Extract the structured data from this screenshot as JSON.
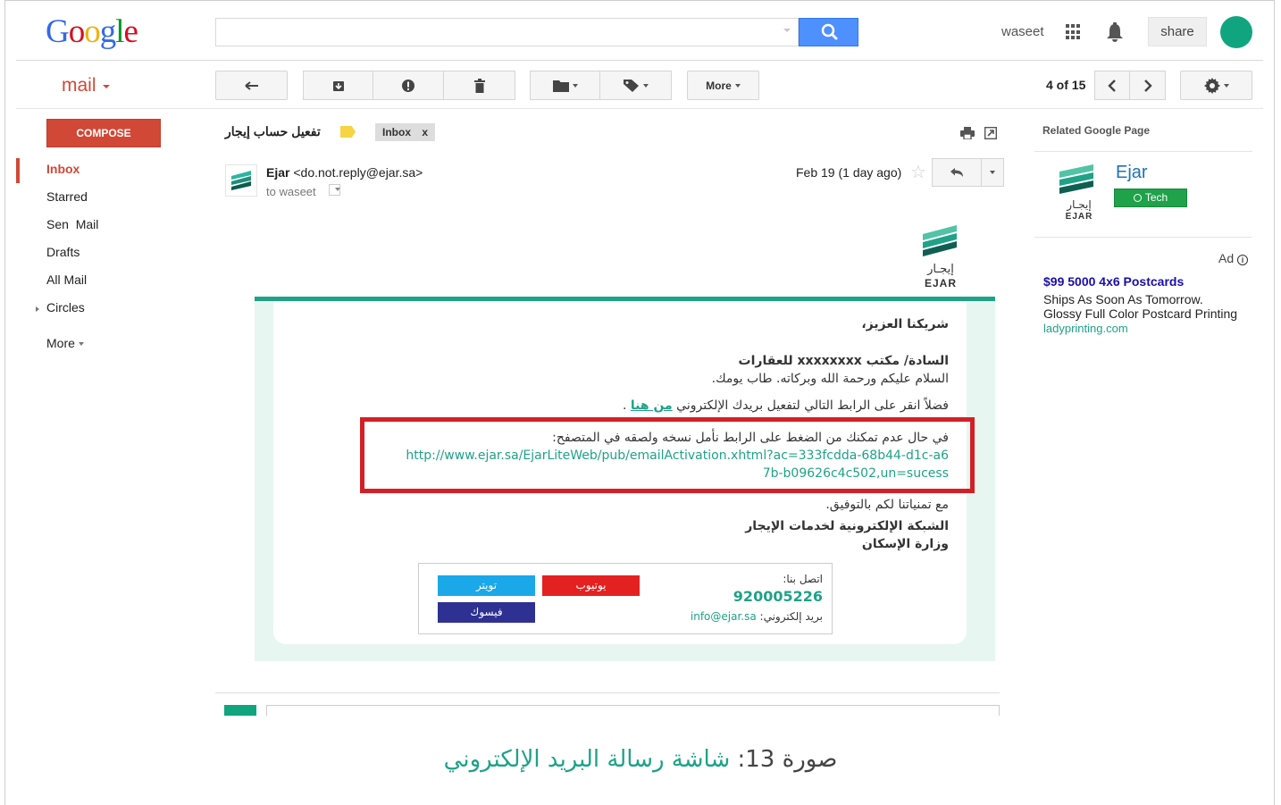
{
  "header": {
    "logo_text": "Google",
    "logo_letters": [
      {
        "ch": "G",
        "color": "#3369e8"
      },
      {
        "ch": "o",
        "color": "#d50f25"
      },
      {
        "ch": "o",
        "color": "#eeb211"
      },
      {
        "ch": "g",
        "color": "#3369e8"
      },
      {
        "ch": "l",
        "color": "#009925"
      },
      {
        "ch": "e",
        "color": "#d50f25"
      }
    ],
    "search_placeholder": "",
    "user_name": "waseet",
    "share_label": "share"
  },
  "toolbar": {
    "mail_label": "mail",
    "more_label": "More",
    "pager": "4 of 15"
  },
  "sidebar": {
    "compose_label": "COMPOSE",
    "items": [
      {
        "label": "Inbox"
      },
      {
        "label": "Starred"
      },
      {
        "label": "Sen  Mail"
      },
      {
        "label": "Drafts"
      },
      {
        "label": "All Mail"
      },
      {
        "label": "Circles"
      },
      {
        "label": "More"
      }
    ]
  },
  "message": {
    "subject": "تفعيل حساب إيجار",
    "inbox_tag": "Inbox",
    "inbox_tag_close": "x",
    "sender_name": "Ejar",
    "sender_email": "<do.not.reply@ejar.sa>",
    "to_line": "to waseet",
    "date": "Feb 19 (1 day ago)"
  },
  "email_body": {
    "logo_arabic": "إيجـار",
    "logo_latin": "EJAR",
    "greeting": "شريكنا العزيز،",
    "addressee": "السادة/ مكتب xxxxxxxx للعقارات",
    "salutation": "السلام عليكم ورحمة الله وبركاته. طاب يومك.",
    "instruction_prefix": "فضلاً انقر على الرابط التالي لتفعيل بريدك الإلكتروني",
    "instruction_link": "من هنا",
    "instruction_suffix": ".",
    "fallback_text": "في حال عدم تمكنك من الضغط على الرابط نأمل نسخه ولصقه في المتصفح:",
    "activation_url_line1": "http://www.ejar.sa/EjarLiteWeb/pub/emailActivation.xhtml?ac=333fcdda-68b44-d1c-a6",
    "activation_url_line2": "7b-b09626c4c502,un=sucess",
    "wishes": "مع تمنياتنا لكم بالتوفيق.",
    "signature_line1": "الشبكة الإلكترونية لخدمات الإيجار",
    "signature_line2": "وزارة الإسكان",
    "contact_label": "اتصل بنا:",
    "contact_phone": "920005226",
    "email_label": "بريد إلكتروني:",
    "contact_email": "info@ejar.sa",
    "social": {
      "youtube": "يوتيوب",
      "twitter": "تويتر",
      "facebook": "فيسوك"
    },
    "colors": {
      "accent": "#1fa287",
      "youtube": "#e42121",
      "twitter": "#1aa8e8",
      "facebook": "#2e3192"
    }
  },
  "right_panel": {
    "title": "Related Google Page",
    "page_name": "Ejar",
    "logo_arabic": "إيجـار",
    "logo_latin": "EJAR",
    "badge": "Tech",
    "ad_label": "Ad",
    "ad_title": "$99 5000 4x6 Postcards",
    "ad_line1": "Ships As Soon As Tomorrow.",
    "ad_line2": "Glossy Full Color Postcard Printing",
    "ad_url": "ladyprinting.com"
  },
  "caption": {
    "prefix": "صورة 13:",
    "title": "شاشة رسالة البريد الإلكتروني",
    "prefix_color": "#444444",
    "title_color": "#1fa287"
  }
}
